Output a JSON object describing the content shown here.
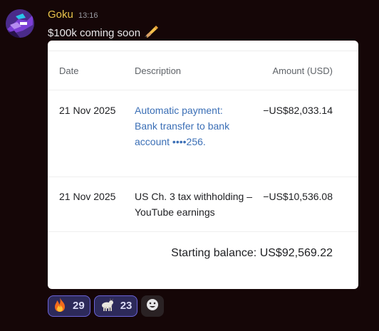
{
  "message": {
    "username": "Goku",
    "timestamp": "13:16",
    "text": "$100k coming soon",
    "text_emoji": "writing-hand-icon",
    "username_color": "#e8c34a"
  },
  "statement": {
    "columns": {
      "date": "Date",
      "description": "Description",
      "amount": "Amount (USD)"
    },
    "rows": [
      {
        "date": "21 Nov 2025",
        "description": "Automatic payment: Bank transfer to bank account ••••256.",
        "amount": "−US$82,033.14",
        "is_link": true
      },
      {
        "date": "21 Nov 2025",
        "description": "US Ch. 3 tax withholding – YouTube earnings",
        "amount": "−US$10,536.08",
        "is_link": false
      }
    ],
    "starting_balance": "Starting balance: US$92,569.22",
    "link_color": "#3b6fb6"
  },
  "reactions": [
    {
      "emoji": "fire-icon",
      "count": "29"
    },
    {
      "emoji": "goat-icon",
      "count": "23"
    }
  ],
  "add_reaction_icon": "add-reaction-smiley-icon"
}
